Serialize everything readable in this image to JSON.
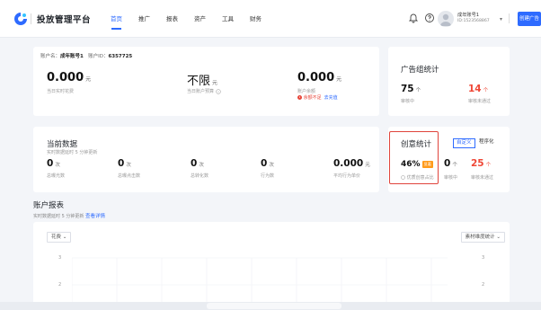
{
  "brand": {
    "name": "投放管理平台"
  },
  "nav": [
    {
      "label": "首页"
    },
    {
      "label": "推广"
    },
    {
      "label": "报表"
    },
    {
      "label": "资产"
    },
    {
      "label": "工具"
    },
    {
      "label": "财务"
    }
  ],
  "account": {
    "name": "成年账号1",
    "id": "ID:1523568867",
    "create_label": "创建广告"
  },
  "account_card": {
    "name_label": "账户名：",
    "name": "成年账号1",
    "id_label": "账户ID：",
    "id": "6357725",
    "today_spend": "0.000",
    "today_spend_unit": "元",
    "today_spend_label": "当日实时花费",
    "budget": "不限",
    "budget_unit": "元",
    "budget_label": "当日账户预算",
    "balance": "0.000",
    "balance_unit": "元",
    "balance_label": "账户余额",
    "balance_warning": "余额不足",
    "recharge_label": "去充值"
  },
  "ad_group": {
    "title": "广告组统计",
    "active": "75",
    "active_unit": "个",
    "active_label": "审核中",
    "rejected": "14",
    "rejected_unit": "个",
    "rejected_label": "审核未通过"
  },
  "current_data": {
    "title": "当前数据",
    "subtitle": "实时数据延时 5 分钟更新",
    "metrics": [
      {
        "value": "0",
        "unit": "次",
        "label": "总曝光数"
      },
      {
        "value": "0",
        "unit": "次",
        "label": "总曝点击数"
      },
      {
        "value": "0",
        "unit": "次",
        "label": "总转化数"
      },
      {
        "value": "0",
        "unit": "次",
        "label": "行为数"
      },
      {
        "value": "0.000",
        "unit": "元",
        "label": "平均行为单价"
      }
    ]
  },
  "creative": {
    "title": "创意统计",
    "custom_label": "自定义",
    "program_label": "程序化",
    "percent": "46%",
    "badge": "显著",
    "percent_label": "优质创意占比",
    "active": "0",
    "active_unit": "个",
    "active_label": "审核中",
    "rejected": "25",
    "rejected_unit": "个",
    "rejected_label": "审核未通过"
  },
  "report": {
    "title": "账户报表",
    "subtitle": "实时数据延时 5 分钟更新",
    "detail_link": "查看详情",
    "metric_select": "花费",
    "dimension_select": "素材维度统计",
    "y_ticks_left": [
      "3",
      "2"
    ],
    "y_ticks_right": [
      "3",
      "2"
    ]
  },
  "colors": {
    "accent": "#2e6bff",
    "danger": "#ef4736",
    "highlight": "#e0443c"
  }
}
